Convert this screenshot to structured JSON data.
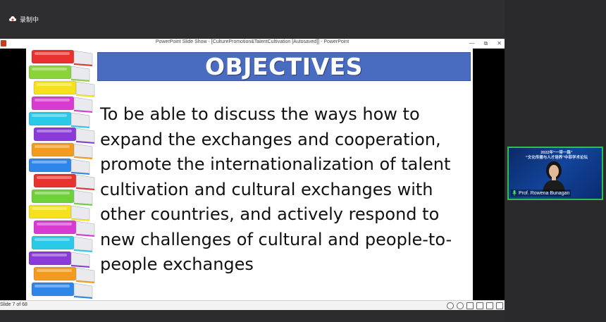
{
  "recording": {
    "label": "录制中"
  },
  "window": {
    "title": "PowerPoint Slide Show - [CulturePromotion&TalentCultivation [Autosaved]] - PowerPoint",
    "controls": [
      "—",
      "⧉",
      "✕"
    ]
  },
  "slide": {
    "heading": "OBJECTIVES",
    "lines": [
      "To be able to discuss the ways how to",
      "expand the exchanges and cooperation,",
      "promote the internationalization of talent",
      "cultivation and cultural exchanges with",
      "other countries, and actively respond to",
      "new challenges of cultural and people-to-",
      "people exchanges"
    ],
    "book_colors": [
      "#e8322e",
      "#8bd33a",
      "#f6e21b",
      "#d83bd2",
      "#2bc9e8",
      "#8a3ad8",
      "#f49a1c",
      "#2e86e8",
      "#e8322e",
      "#6fd13a",
      "#f6e21b",
      "#d83bd2",
      "#2bc9e8",
      "#8a3ad8",
      "#f49a1c",
      "#2e86e8"
    ]
  },
  "status": {
    "slide_counter": "Slide 7 of 68"
  },
  "participant": {
    "banner_line1": "2022年“一带一路”",
    "banner_line2": "“文化传播与人才培养”中菲学术论坛",
    "name": "Prof. Rowena Bunagan"
  },
  "colors": {
    "banner": "#4a6cc0",
    "tile_border": "#2fbf4f",
    "record_icon": "#e03a3a"
  }
}
